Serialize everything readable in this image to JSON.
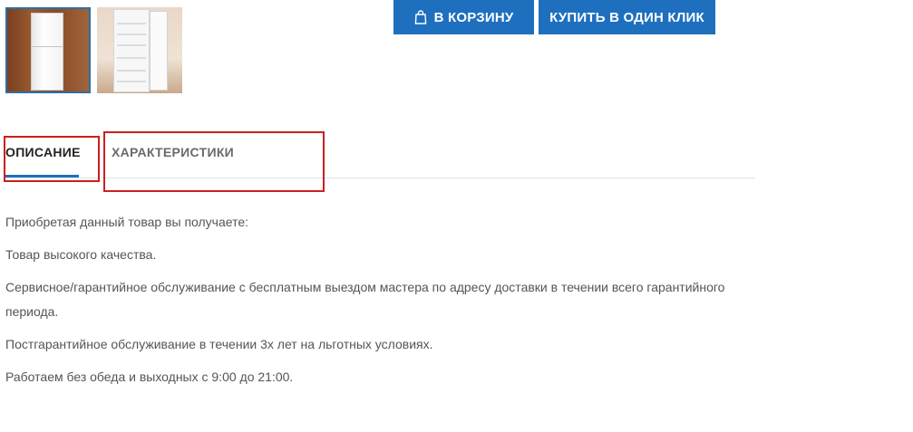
{
  "gallery": {
    "thumbnails": [
      {
        "name": "fridge-closed-thumbnail",
        "selected": true
      },
      {
        "name": "fridge-open-thumbnail",
        "selected": false
      }
    ]
  },
  "actions": {
    "cart_label": "В КОРЗИНУ",
    "cart_icon": "shopping-bag-icon",
    "one_click_label": "КУПИТЬ В ОДИН КЛИК",
    "button_color": "#1f6fbf"
  },
  "tabs": [
    {
      "label": "ОПИСАНИЕ",
      "active": true
    },
    {
      "label": "ХАРАКТЕРИСТИКИ",
      "active": false
    }
  ],
  "description": {
    "paragraphs": [
      "Приобретая данный товар вы получаете:",
      "Товар высокого качества.",
      "Сервисное/гарантийное обслуживание с бесплатным выездом мастера по адресу доставки в течении всего гарантийного периода.",
      "Постгарантийное обслуживание в течении 3х лет на льготных условиях.",
      "Работаем без обеда и выходных с 9:00 до 21:00."
    ]
  },
  "annotations": {
    "highlight_color": "#cc1f1f"
  }
}
